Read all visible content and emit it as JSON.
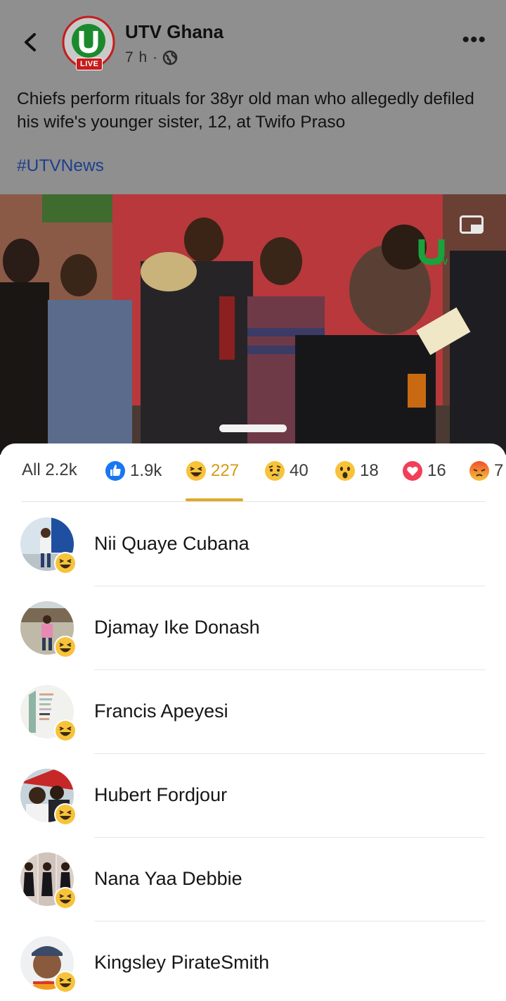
{
  "post": {
    "page_name": "UTV Ghana",
    "live_label": "LIVE",
    "time": "7 h ·",
    "caption": "Chiefs perform rituals for 38yr old man who allegedly defiled his wife's younger sister, 12, at Twifo Praso",
    "hashtag": "#UTVNews"
  },
  "reactions": {
    "tabs": [
      {
        "label": "All 2.2k",
        "icon": "none"
      },
      {
        "label": "1.9k",
        "icon": "like-icon"
      },
      {
        "label": "227",
        "icon": "haha-icon",
        "active": true
      },
      {
        "label": "40",
        "icon": "sad-icon"
      },
      {
        "label": "18",
        "icon": "wow-icon"
      },
      {
        "label": "16",
        "icon": "love-icon"
      },
      {
        "label": "7",
        "icon": "angry-icon"
      }
    ],
    "people": [
      {
        "name": "Nii Quaye Cubana"
      },
      {
        "name": "Djamay Ike Donash"
      },
      {
        "name": "Francis Apeyesi"
      },
      {
        "name": "Hubert Fordjour"
      },
      {
        "name": "Nana Yaa Debbie"
      },
      {
        "name": "Kingsley PirateSmith"
      }
    ]
  },
  "colors": {
    "accent_active_tab": "#d59a16",
    "hashtag": "#1d3f8e",
    "like_blue": "#1877f2",
    "live_red": "#c61c1c"
  }
}
